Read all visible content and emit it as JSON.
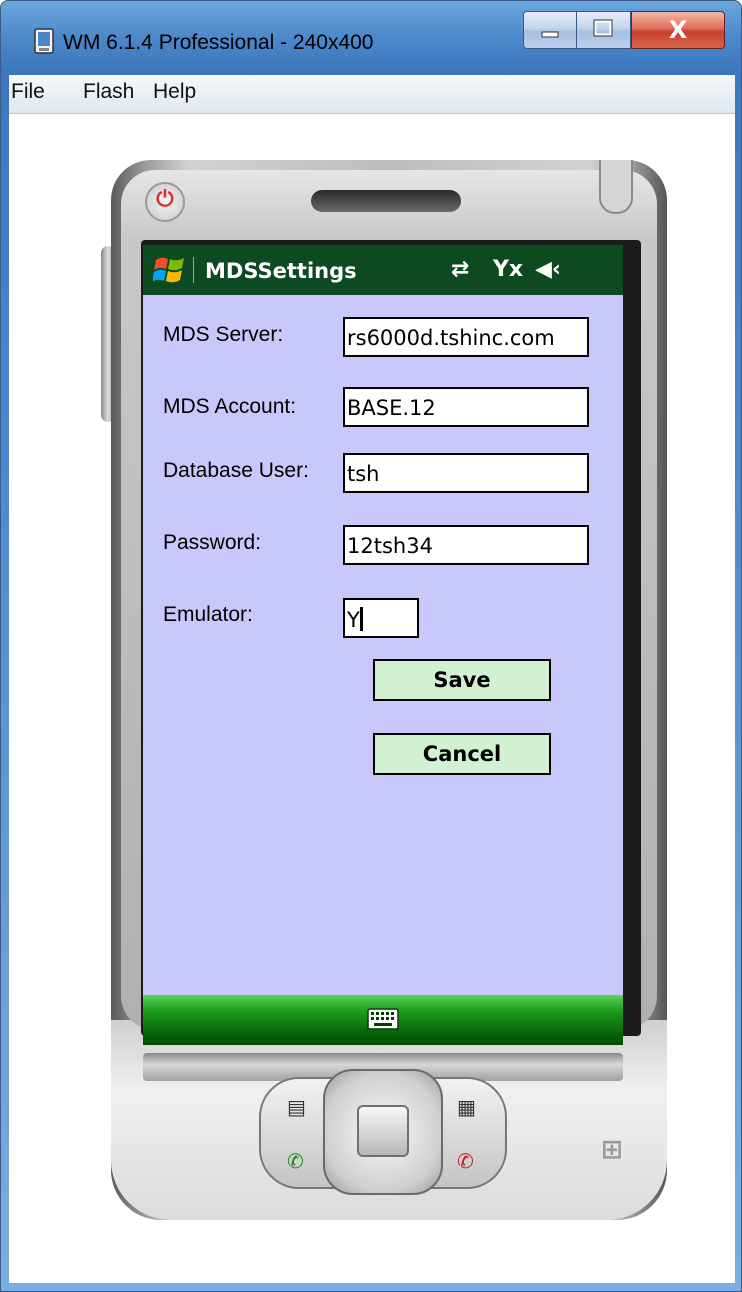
{
  "window": {
    "title": "WM 6.1.4 Professional - 240x400",
    "close_glyph": "X"
  },
  "menubar": {
    "items": [
      "File",
      "Flash",
      "Help"
    ]
  },
  "device": {
    "power_glyph": "⏻"
  },
  "screen": {
    "app_title": "MDSSettings",
    "status_icons": {
      "sync": "⇄",
      "signal": "Yx",
      "volume": "◀‹"
    },
    "form": {
      "mds_server": {
        "label": "MDS Server:",
        "value": "rs6000d.tshinc.com"
      },
      "mds_account": {
        "label": "MDS Account:",
        "value": "BASE.12"
      },
      "database_user": {
        "label": "Database User:",
        "value": "tsh"
      },
      "password": {
        "label": "Password:",
        "value": "12tsh34"
      },
      "emulator": {
        "label": "Emulator:",
        "value": "Y"
      }
    },
    "buttons": {
      "save": "Save",
      "cancel": "Cancel"
    },
    "colors": {
      "form_background": "#c8c8fa",
      "status_bar": "#0d4a22",
      "button_fill": "#d2f0d2"
    }
  },
  "keypad": {
    "icons": [
      "contacts-icon",
      "calendar-icon",
      "call-icon",
      "end-call-icon"
    ]
  }
}
